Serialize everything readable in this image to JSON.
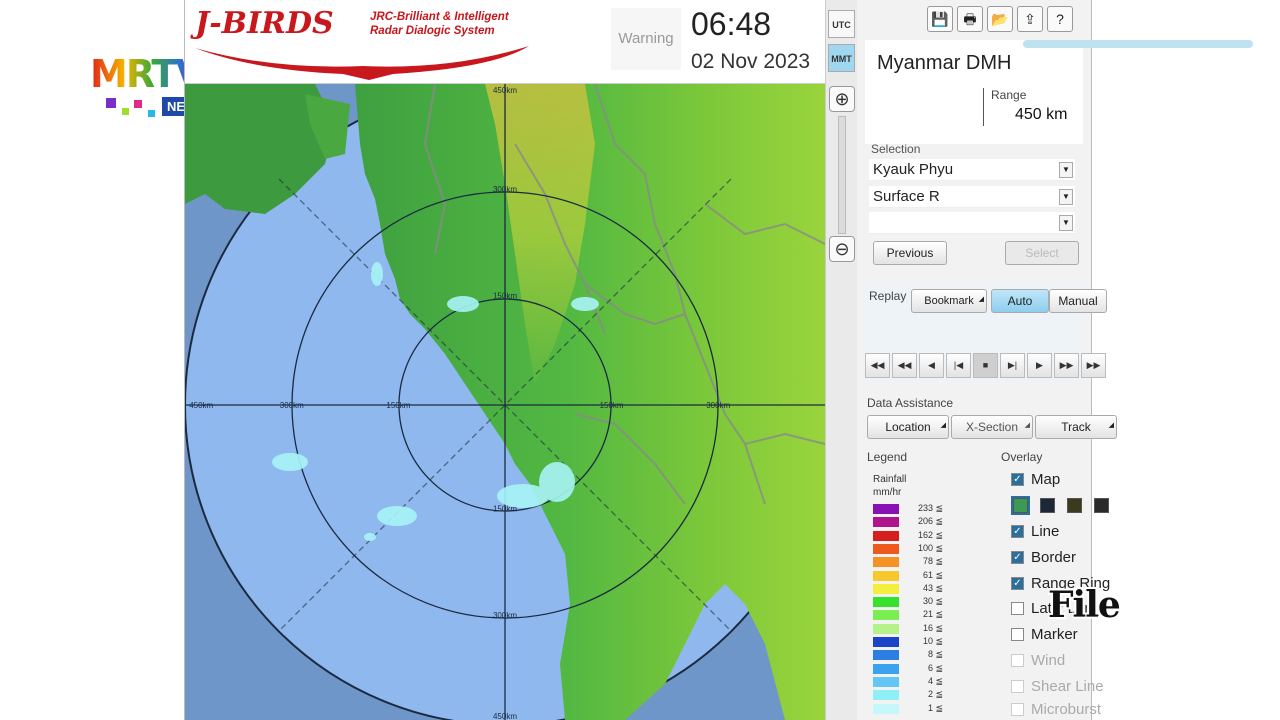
{
  "broadcaster": {
    "logo": "MRTV",
    "tag": "NEWS"
  },
  "app": {
    "brand": "J-BIRDS",
    "subtitle_line1": "JRC-Brilliant & Intelligent",
    "subtitle_line2": "Radar Dialogic System",
    "warning": "Warning",
    "time": "06:48",
    "date": "02 Nov 2023",
    "tz_utc": "UTC",
    "tz_mmt": "MMT"
  },
  "toolbar": {
    "save_icon": "💾",
    "print_icon": "🖶",
    "open_icon": "📂",
    "export_icon": "⇪",
    "help_icon": "?"
  },
  "station": {
    "name": "Myanmar DMH",
    "range_label": "Range",
    "range_value": "450 km"
  },
  "selection": {
    "label": "Selection",
    "site": "Kyauk Phyu",
    "product": "Surface R",
    "third": "",
    "previous": "Previous",
    "select": "Select"
  },
  "replay": {
    "label": "Replay",
    "bookmark": "Bookmark",
    "auto": "Auto",
    "manual": "Manual"
  },
  "playback": [
    "◀◀",
    "◀◀",
    "◀",
    "|◀",
    "■",
    "▶|",
    "▶",
    "▶▶",
    "▶▶"
  ],
  "data_assistance": {
    "label": "Data Assistance",
    "location": "Location",
    "xsection": "X-Section",
    "track": "Track"
  },
  "legend": {
    "title": "Legend",
    "unit_line1": "Rainfall",
    "unit_line2": "mm/hr",
    "entries": [
      {
        "value": "233 ≦",
        "color": "#8a12b4"
      },
      {
        "value": "206 ≦",
        "color": "#b0148c"
      },
      {
        "value": "162 ≦",
        "color": "#d61e1e"
      },
      {
        "value": "100 ≦",
        "color": "#ee5a1c"
      },
      {
        "value": "78 ≦",
        "color": "#f49226"
      },
      {
        "value": "61 ≦",
        "color": "#f7c82a"
      },
      {
        "value": "43 ≦",
        "color": "#f5ee3c"
      },
      {
        "value": "30 ≦",
        "color": "#36e22c"
      },
      {
        "value": "21 ≦",
        "color": "#7bee52"
      },
      {
        "value": "16 ≦",
        "color": "#b6f28a"
      },
      {
        "value": "10 ≦",
        "color": "#1c44c8"
      },
      {
        "value": "8 ≦",
        "color": "#2c7ee2"
      },
      {
        "value": "6 ≦",
        "color": "#3aa2ee"
      },
      {
        "value": "4 ≦",
        "color": "#64c6f6"
      },
      {
        "value": "2 ≦",
        "color": "#8ef0f6"
      },
      {
        "value": "1 ≦",
        "color": "#c6f8fb"
      }
    ]
  },
  "overlay": {
    "title": "Overlay",
    "items": [
      {
        "label": "Map",
        "checked": true,
        "enabled": true
      },
      {
        "label": "Line",
        "checked": true,
        "enabled": true
      },
      {
        "label": "Border",
        "checked": true,
        "enabled": true
      },
      {
        "label": "Range Ring",
        "checked": true,
        "enabled": true
      },
      {
        "label": "Lati / Long",
        "checked": false,
        "enabled": true
      },
      {
        "label": "Marker",
        "checked": false,
        "enabled": true
      },
      {
        "label": "Wind",
        "checked": false,
        "enabled": false
      },
      {
        "label": "Shear Line",
        "checked": false,
        "enabled": false
      },
      {
        "label": "Microburst",
        "checked": false,
        "enabled": false
      }
    ],
    "map_styles": [
      "#3a9a56",
      "#1c2838",
      "#3b3a1c",
      "#2a2a2a"
    ]
  },
  "range_rings": {
    "left_labels": [
      "450km",
      "300km",
      "150km"
    ],
    "right_labels": [
      "150km",
      "300km"
    ],
    "top_labels": [
      "450km",
      "300km",
      "150km"
    ],
    "bottom_labels": [
      "150km",
      "300km",
      "450km"
    ]
  },
  "watermark": "File"
}
